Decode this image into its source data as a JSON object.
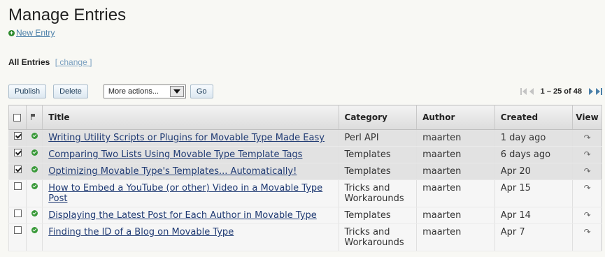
{
  "header": {
    "title": "Manage Entries",
    "new_entry_label": "New Entry"
  },
  "filter": {
    "label": "All Entries",
    "change_label": "[ change ]"
  },
  "actions": {
    "publish_label": "Publish",
    "delete_label": "Delete",
    "more_actions_value": "More actions...",
    "go_label": "Go"
  },
  "pagination": {
    "range": "1 – 25 of 48"
  },
  "table": {
    "columns": {
      "title": "Title",
      "category": "Category",
      "author": "Author",
      "created": "Created",
      "view": "View"
    },
    "rows": [
      {
        "checked": true,
        "title": "Writing Utility Scripts or Plugins for Movable Type Made Easy",
        "category": "Perl API",
        "author": "maarten",
        "created": "1 day ago"
      },
      {
        "checked": true,
        "title": "Comparing Two Lists Using Movable Type Template Tags",
        "category": "Templates",
        "author": "maarten",
        "created": "6 days ago"
      },
      {
        "checked": true,
        "title": "Optimizing Movable Type's Templates... Automatically!",
        "category": "Templates",
        "author": "maarten",
        "created": "Apr 20"
      },
      {
        "checked": false,
        "title": "How to Embed a YouTube (or other) Video in a Movable Type Post",
        "category": "Tricks and Workarounds",
        "author": "maarten",
        "created": "Apr 15"
      },
      {
        "checked": false,
        "title": "Displaying the Latest Post for Each Author in Movable Type",
        "category": "Templates",
        "author": "maarten",
        "created": "Apr 14"
      },
      {
        "checked": false,
        "title": "Finding the ID of a Blog on Movable Type",
        "category": "Tricks and Workarounds",
        "author": "maarten",
        "created": "Apr 7"
      }
    ]
  },
  "colors": {
    "link": "#1f3a73",
    "status_green": "#3a9a3a",
    "selected_row": "#e2e2e2"
  },
  "icons": {
    "new_entry": "plus-icon",
    "status": "published-check-icon",
    "view": "view-arrow-icon"
  }
}
